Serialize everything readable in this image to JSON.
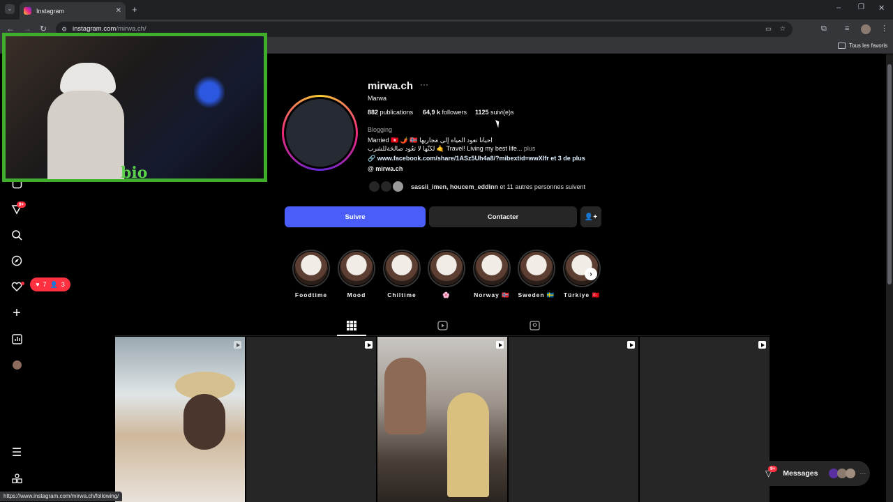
{
  "browser": {
    "tab_title": "Instagram",
    "url_host": "instagram.com",
    "url_path": "/mirwa.ch/",
    "bookmarks_label": "Tous les favoris",
    "status_url": "https://www.instagram.com/mirwa.ch/following/"
  },
  "profile": {
    "username": "mirwa.ch",
    "more": "···",
    "full_name": "Marwa",
    "posts_count": "882",
    "posts_label": "publications",
    "followers_count": "64,9 k",
    "followers_label": "followers",
    "following_count": "1125",
    "following_label": "suivi(e)s",
    "category": "Blogging",
    "bio_line1": "Married 🇹🇳 🌶️ 🇳🇴 احيانا تعود المياه إلى مَجاريها",
    "bio_line2": "لكنّها لا تعُود صالحَةللشرب 🤙 Travel! Living my best life...",
    "bio_more": "plus",
    "link": "www.facebook.com/share/1ASz5Uh4a8/?mibextid=wwXIfr et 3 de plus",
    "threads": "mirwa.ch",
    "followed_by_names": "sassii_imen, houcem_eddinn",
    "followed_by_rest": " et 11 autres personnes suivent"
  },
  "actions": {
    "follow": "Suivre",
    "contact": "Contacter"
  },
  "highlights": [
    {
      "label": "Foodtime"
    },
    {
      "label": "Mood"
    },
    {
      "label": "Chiltime"
    },
    {
      "label": "🌸"
    },
    {
      "label": "Norway 🇳🇴"
    },
    {
      "label": "Sweden 🇸🇪"
    },
    {
      "label": "Türkiye 🇹🇷"
    }
  ],
  "notifications": {
    "likes": "7",
    "follows": "3",
    "badge": "9+"
  },
  "messages": {
    "label": "Messages",
    "badge": "9+"
  },
  "overlay": {
    "logo_text": "bio"
  },
  "colors": {
    "follow_button": "#4a5df9",
    "notif_pill": "#ff3040",
    "overlay_frame": "#3fae2a"
  }
}
